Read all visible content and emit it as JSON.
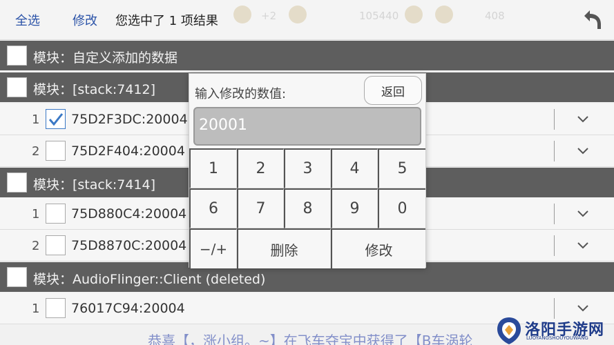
{
  "toolbar": {
    "select_all": "全选",
    "modify": "修改",
    "status": "您选中了 1 项结果",
    "bg_values": [
      "+2",
      "105440",
      "408"
    ]
  },
  "rows": [
    {
      "type": "module",
      "label": "模块：自定义添加的数据"
    },
    {
      "type": "module",
      "label": "模块：[stack:7412]"
    },
    {
      "type": "item",
      "index": "1",
      "address": "75D2F3DC:20004",
      "checked": true
    },
    {
      "type": "item",
      "index": "2",
      "address": "75D2F404:20004",
      "checked": false
    },
    {
      "type": "module",
      "label": "模块：[stack:7414]"
    },
    {
      "type": "item",
      "index": "1",
      "address": "75D880C4:20004",
      "checked": false
    },
    {
      "type": "item",
      "index": "2",
      "address": "75D8870C:20004",
      "checked": false
    },
    {
      "type": "module",
      "label": "模块：AudioFlinger::Client (deleted)"
    },
    {
      "type": "item",
      "index": "1",
      "address": "76017C94:20004",
      "checked": false
    }
  ],
  "dialog": {
    "title": "输入修改的数值:",
    "back_label": "返回",
    "input_value": "20001",
    "keys_row1": [
      "1",
      "2",
      "3",
      "4",
      "5"
    ],
    "keys_row2": [
      "6",
      "7",
      "8",
      "9",
      "0"
    ],
    "key_sign": "−/+",
    "key_delete": "删除",
    "key_modify": "修改"
  },
  "banner": "恭喜【，涨小组。~】在飞车夺宝中获得了【B车涡轮",
  "watermark": {
    "title": "洛阳手游网",
    "subtitle": "LUOYANGSHOUYOUWANG"
  },
  "colors": {
    "link": "#2b53a8",
    "module_bg": "#5e5e5e",
    "check_accent": "#3a78c5"
  }
}
